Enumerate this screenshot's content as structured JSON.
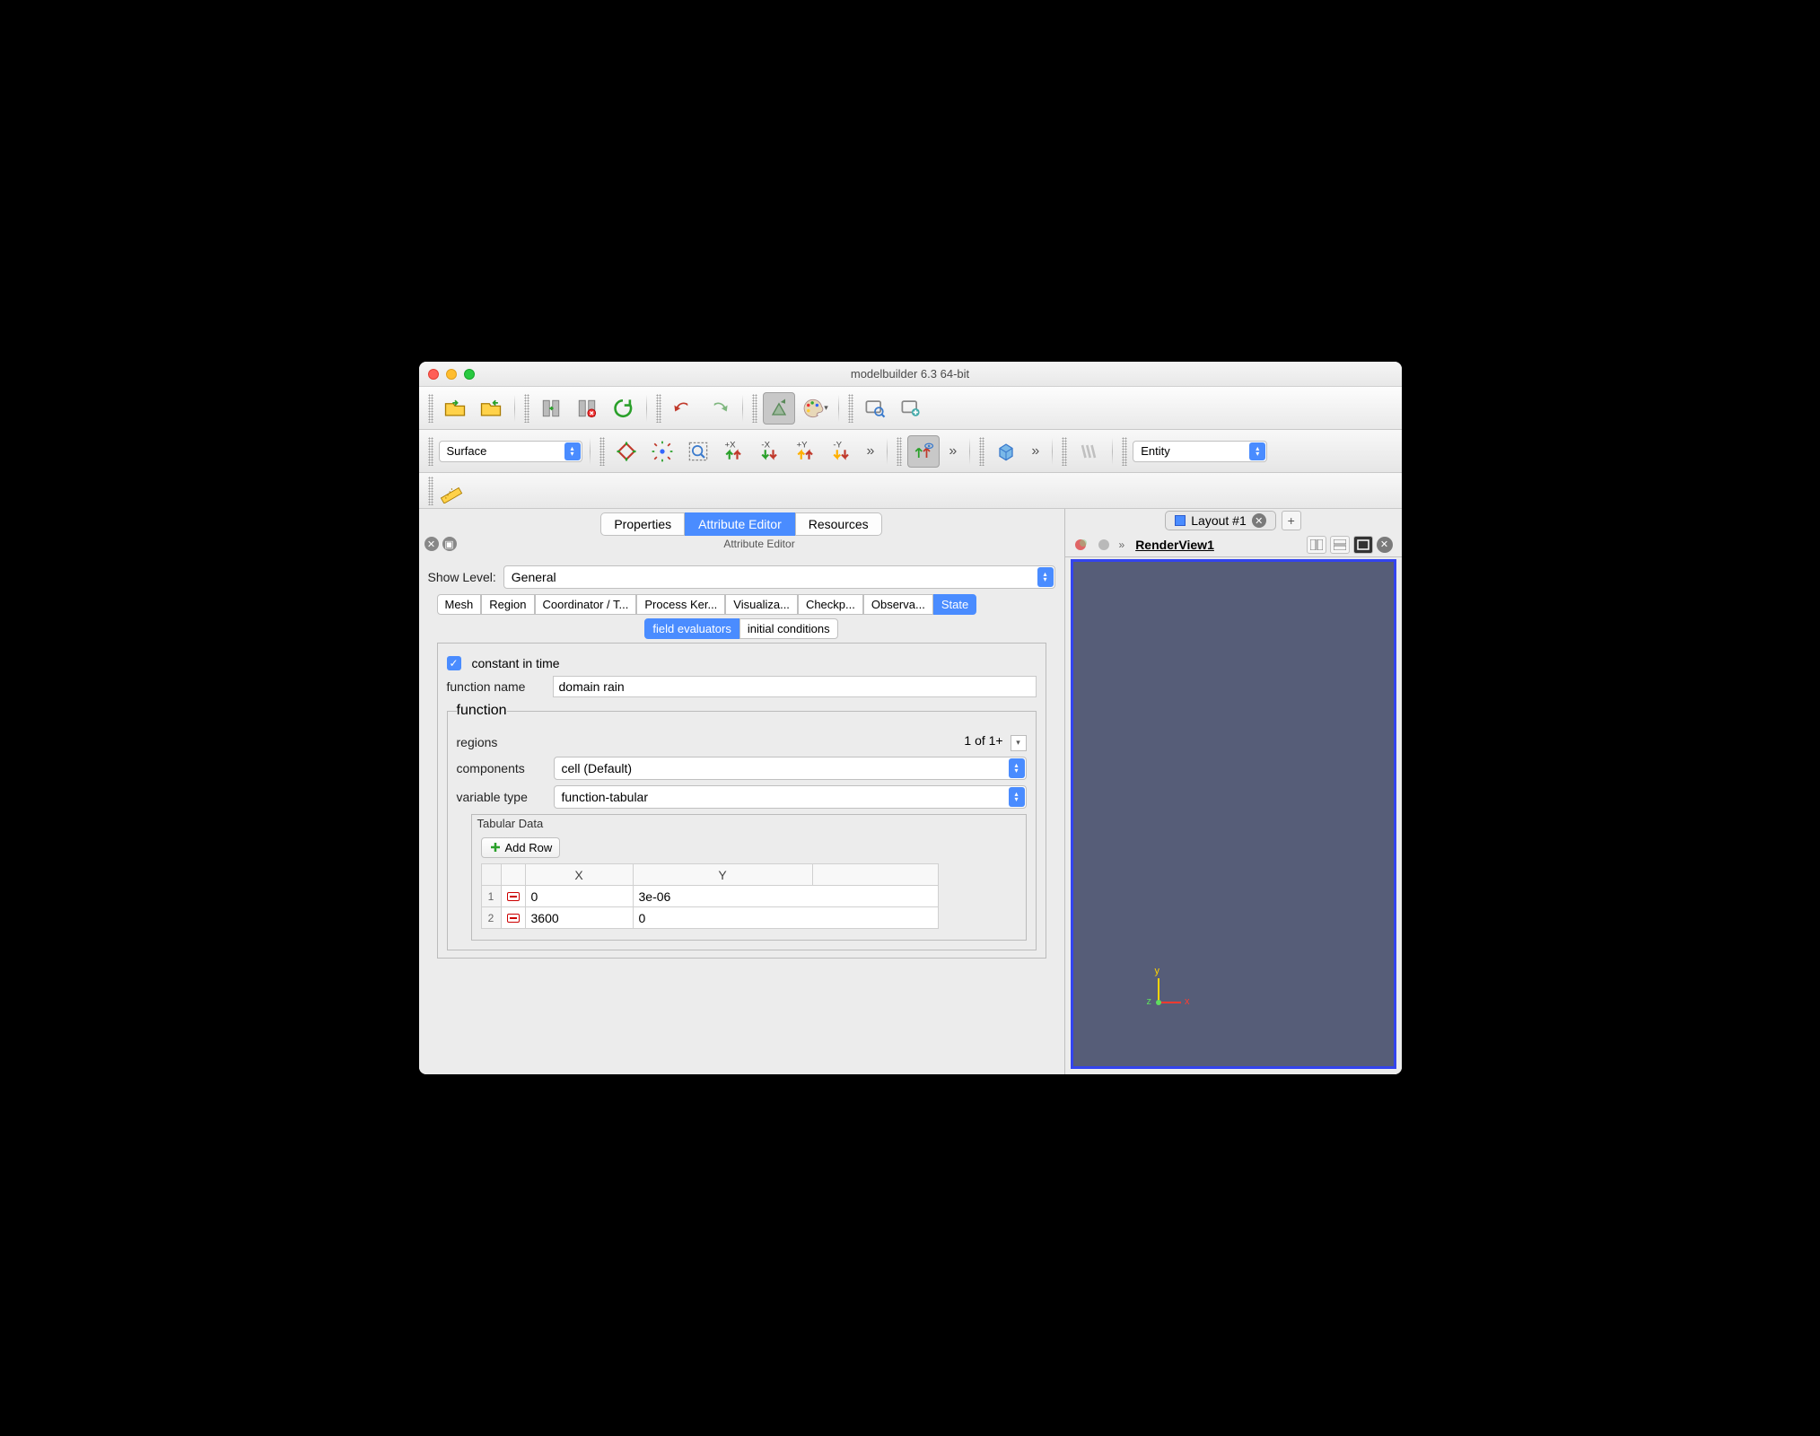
{
  "window": {
    "title": "modelbuilder 6.3 64-bit"
  },
  "toolbar": {
    "surface_combo": "Surface",
    "entity_combo": "Entity"
  },
  "main_tabs": {
    "properties": "Properties",
    "attribute_editor": "Attribute Editor",
    "resources": "Resources"
  },
  "panel": {
    "title": "Attribute Editor",
    "show_level_label": "Show Level:",
    "show_level_value": "General"
  },
  "attr_tabs": {
    "mesh": "Mesh",
    "region": "Region",
    "coord": "Coordinator / T...",
    "process": "Process Ker...",
    "visual": "Visualiza...",
    "checkp": "Checkp...",
    "observa": "Observa...",
    "state": "State"
  },
  "inner_tabs": {
    "field": "field evaluators",
    "initial": "initial conditions"
  },
  "form": {
    "constant_in_time": "constant in time",
    "function_name_label": "function name",
    "function_name_value": "domain rain",
    "function_legend": "function",
    "regions_label": "regions",
    "regions_count": "1 of 1+",
    "components_label": "components",
    "components_value": "cell (Default)",
    "vartype_label": "variable type",
    "vartype_value": "function-tabular",
    "tabular_title": "Tabular Data",
    "add_row": "Add Row",
    "col_x": "X",
    "col_y": "Y",
    "rows": [
      {
        "n": "1",
        "x": "0",
        "y": "3e-06"
      },
      {
        "n": "2",
        "x": "3600",
        "y": "0"
      }
    ]
  },
  "layout": {
    "tab": "Layout #1",
    "renderview": "RenderView1"
  }
}
